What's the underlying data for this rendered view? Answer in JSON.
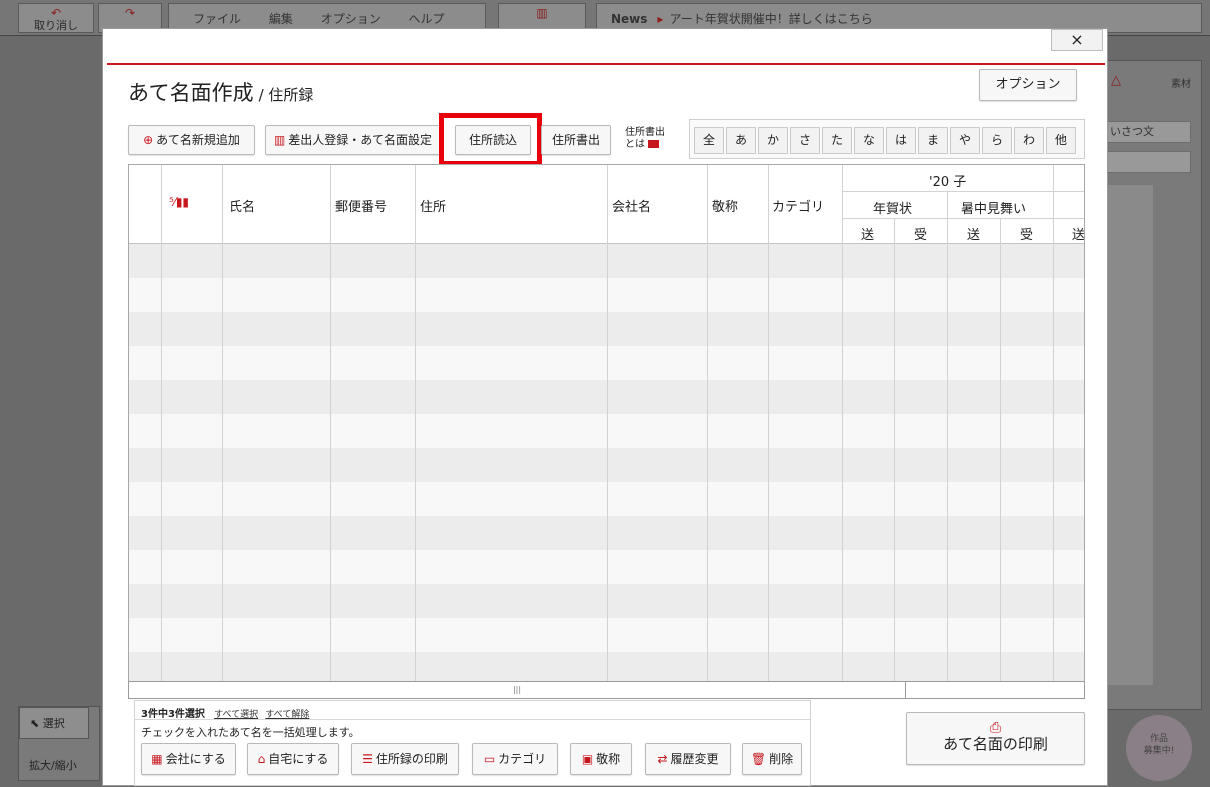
{
  "background": {
    "undo_label": "取り消し",
    "menu": [
      "ファイル",
      "編集",
      "オプション",
      "ヘルプ"
    ],
    "news_label": "News",
    "news_text": "アート年賀状開催中！詳しくはこちら",
    "side_title": "素材",
    "side_field": "いさつ文",
    "select_label": "選択",
    "zoom_label": "拡大/縮小",
    "campaign": "作品\n募集中!"
  },
  "dialog": {
    "close": "×",
    "title": "あて名面作成",
    "subtitle": "/ 住所録",
    "option_button": "オプション",
    "toolbar": {
      "add": "あて名新規追加",
      "sender": "差出人登録・あて名面設定",
      "import": "住所読込",
      "export": "住所書出",
      "about_line1": "住所書出",
      "about_line2": "とは"
    },
    "kana": [
      "全",
      "あ",
      "か",
      "さ",
      "た",
      "な",
      "は",
      "ま",
      "や",
      "ら",
      "わ",
      "他"
    ],
    "table": {
      "headers": {
        "name": "氏名",
        "zip": "郵便番号",
        "address": "住所",
        "company": "会社名",
        "honorific": "敬称",
        "category": "カテゴリ",
        "year": "'20 子",
        "nenga": "年賀状",
        "shochu": "暑中見舞い",
        "send": "送",
        "recv": "受"
      },
      "rows": 13
    },
    "footer": {
      "count": "3件中3件選択",
      "select_all": "すべて選択",
      "clear_all": "すべて解除",
      "note": "チェックを入れたあて名を一括処理します。",
      "buttons": [
        "会社にする",
        "自宅にする",
        "住所録の印刷",
        "カテゴリ",
        "敬称",
        "履歴変更",
        "削除"
      ],
      "print": "あて名面の印刷"
    }
  },
  "colors": {
    "accent": "#c8161d",
    "highlight": "#e8000b"
  }
}
